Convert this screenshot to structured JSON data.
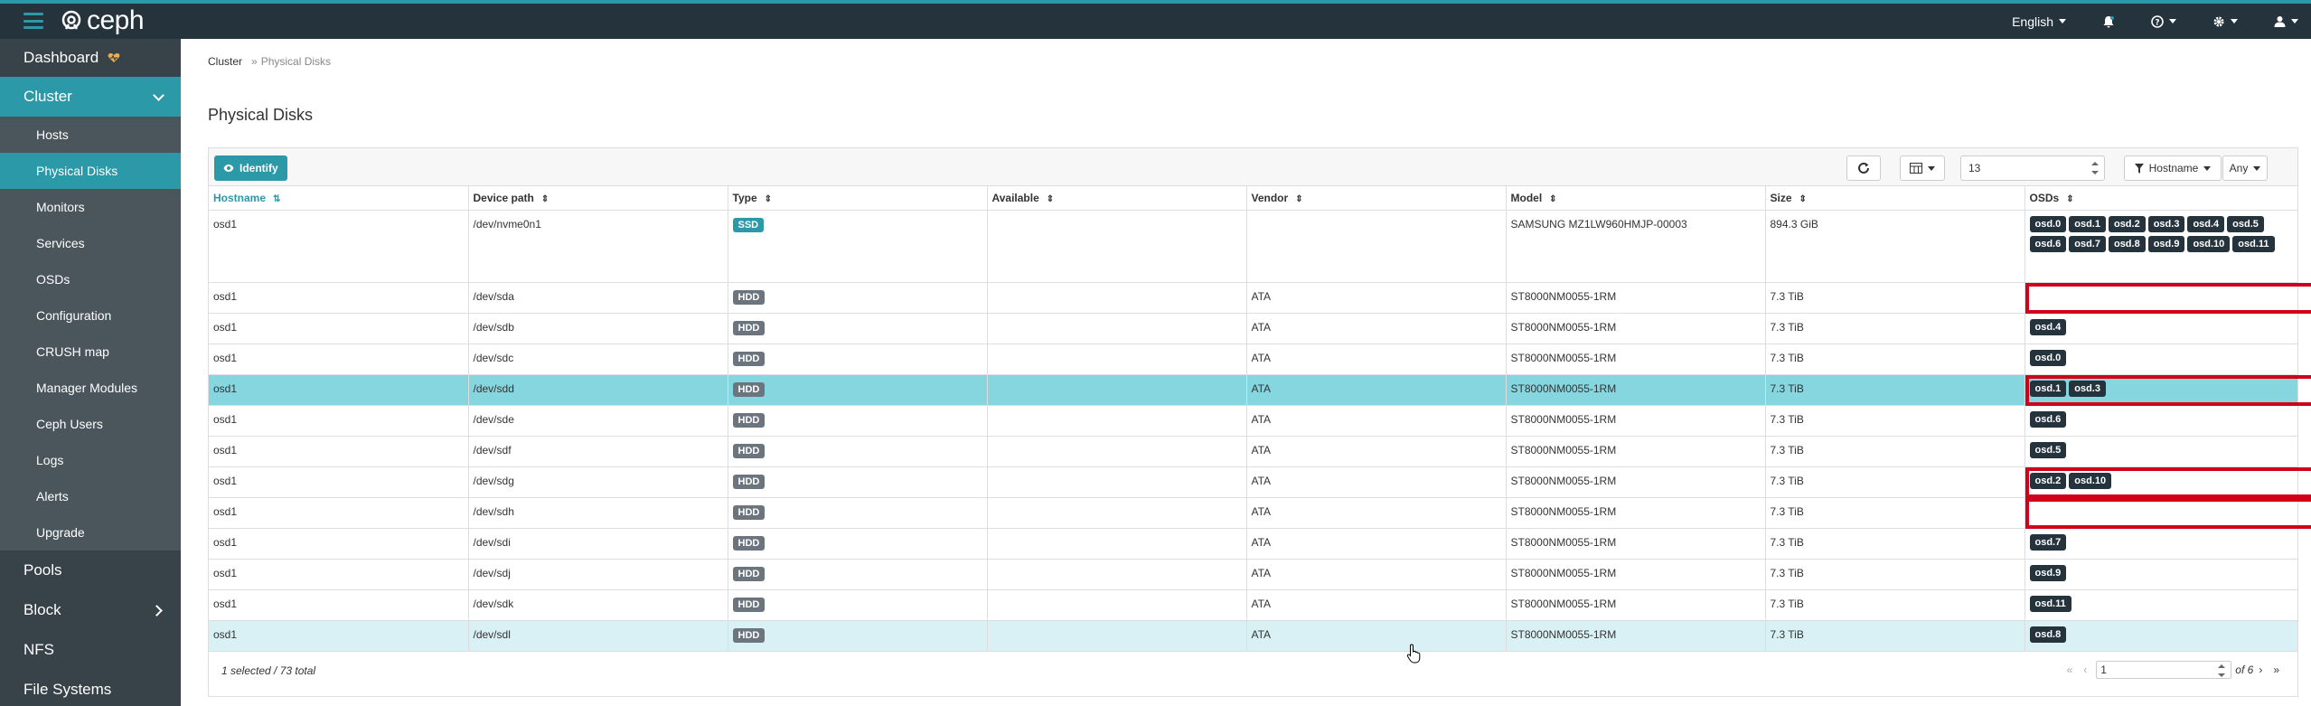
{
  "app": {
    "name": "ceph"
  },
  "header": {
    "language": "English"
  },
  "sidebar": {
    "items": [
      {
        "label": "Dashboard",
        "type": "top"
      },
      {
        "label": "Cluster",
        "type": "top",
        "active": true
      },
      {
        "label": "Hosts",
        "type": "sub"
      },
      {
        "label": "Physical Disks",
        "type": "sub",
        "active": true
      },
      {
        "label": "Monitors",
        "type": "sub"
      },
      {
        "label": "Services",
        "type": "sub"
      },
      {
        "label": "OSDs",
        "type": "sub"
      },
      {
        "label": "Configuration",
        "type": "sub"
      },
      {
        "label": "CRUSH map",
        "type": "sub"
      },
      {
        "label": "Manager Modules",
        "type": "sub"
      },
      {
        "label": "Ceph Users",
        "type": "sub"
      },
      {
        "label": "Logs",
        "type": "sub"
      },
      {
        "label": "Alerts",
        "type": "sub"
      },
      {
        "label": "Upgrade",
        "type": "sub"
      },
      {
        "label": "Pools",
        "type": "top"
      },
      {
        "label": "Block",
        "type": "top"
      },
      {
        "label": "NFS",
        "type": "top"
      },
      {
        "label": "File Systems",
        "type": "top"
      }
    ]
  },
  "breadcrumb": {
    "root": "Cluster",
    "sep": "»",
    "current": "Physical Disks"
  },
  "page": {
    "title": "Physical Disks"
  },
  "toolbar": {
    "identify_label": "Identify",
    "limit_value": "13",
    "filter_label": "Hostname",
    "filter_value": "Any"
  },
  "table": {
    "columns": [
      "Hostname",
      "Device path",
      "Type",
      "Available",
      "Vendor",
      "Model",
      "Size",
      "OSDs"
    ],
    "rows": [
      {
        "host": "osd1",
        "path": "/dev/nvme0n1",
        "type": "SSD",
        "available": "",
        "vendor": "",
        "model": "SAMSUNG MZ1LW960HMJP-00003",
        "size": "894.3 GiB",
        "osds": [
          "osd.0",
          "osd.1",
          "osd.2",
          "osd.3",
          "osd.4",
          "osd.5",
          "osd.6",
          "osd.7",
          "osd.8",
          "osd.9",
          "osd.10",
          "osd.11"
        ]
      },
      {
        "host": "osd1",
        "path": "/dev/sda",
        "type": "HDD",
        "available": "",
        "vendor": "ATA",
        "model": "ST8000NM0055-1RM",
        "size": "7.3 TiB",
        "osds": []
      },
      {
        "host": "osd1",
        "path": "/dev/sdb",
        "type": "HDD",
        "available": "",
        "vendor": "ATA",
        "model": "ST8000NM0055-1RM",
        "size": "7.3 TiB",
        "osds": [
          "osd.4"
        ]
      },
      {
        "host": "osd1",
        "path": "/dev/sdc",
        "type": "HDD",
        "available": "",
        "vendor": "ATA",
        "model": "ST8000NM0055-1RM",
        "size": "7.3 TiB",
        "osds": [
          "osd.0"
        ]
      },
      {
        "host": "osd1",
        "path": "/dev/sdd",
        "type": "HDD",
        "available": "",
        "vendor": "ATA",
        "model": "ST8000NM0055-1RM",
        "size": "7.3 TiB",
        "osds": [
          "osd.1",
          "osd.3"
        ]
      },
      {
        "host": "osd1",
        "path": "/dev/sde",
        "type": "HDD",
        "available": "",
        "vendor": "ATA",
        "model": "ST8000NM0055-1RM",
        "size": "7.3 TiB",
        "osds": [
          "osd.6"
        ]
      },
      {
        "host": "osd1",
        "path": "/dev/sdf",
        "type": "HDD",
        "available": "",
        "vendor": "ATA",
        "model": "ST8000NM0055-1RM",
        "size": "7.3 TiB",
        "osds": [
          "osd.5"
        ]
      },
      {
        "host": "osd1",
        "path": "/dev/sdg",
        "type": "HDD",
        "available": "",
        "vendor": "ATA",
        "model": "ST8000NM0055-1RM",
        "size": "7.3 TiB",
        "osds": [
          "osd.2",
          "osd.10"
        ]
      },
      {
        "host": "osd1",
        "path": "/dev/sdh",
        "type": "HDD",
        "available": "",
        "vendor": "ATA",
        "model": "ST8000NM0055-1RM",
        "size": "7.3 TiB",
        "osds": []
      },
      {
        "host": "osd1",
        "path": "/dev/sdi",
        "type": "HDD",
        "available": "",
        "vendor": "ATA",
        "model": "ST8000NM0055-1RM",
        "size": "7.3 TiB",
        "osds": [
          "osd.7"
        ]
      },
      {
        "host": "osd1",
        "path": "/dev/sdj",
        "type": "HDD",
        "available": "",
        "vendor": "ATA",
        "model": "ST8000NM0055-1RM",
        "size": "7.3 TiB",
        "osds": [
          "osd.9"
        ]
      },
      {
        "host": "osd1",
        "path": "/dev/sdk",
        "type": "HDD",
        "available": "",
        "vendor": "ATA",
        "model": "ST8000NM0055-1RM",
        "size": "7.3 TiB",
        "osds": [
          "osd.11"
        ]
      },
      {
        "host": "osd1",
        "path": "/dev/sdl",
        "type": "HDD",
        "available": "",
        "vendor": "ATA",
        "model": "ST8000NM0055-1RM",
        "size": "7.3 TiB",
        "osds": [
          "osd.8"
        ]
      }
    ]
  },
  "footer": {
    "summary": "1 selected / 73 total",
    "page_value": "1",
    "page_of": "of 6"
  }
}
